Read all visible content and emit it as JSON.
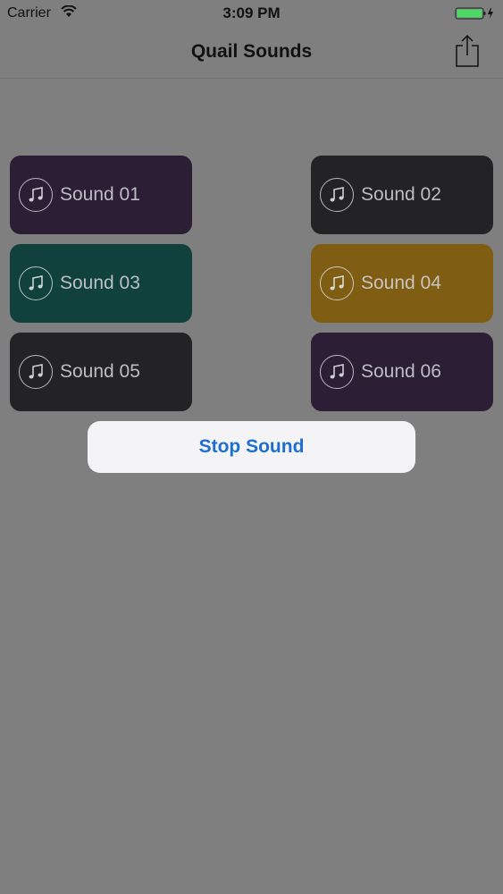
{
  "status_bar": {
    "carrier": "Carrier",
    "time": "3:09 PM"
  },
  "nav": {
    "title": "Quail Sounds"
  },
  "sounds": [
    {
      "label": "Sound 01",
      "color": "#2b1e35"
    },
    {
      "label": "Sound 02",
      "color": "#232326"
    },
    {
      "label": "Sound 03",
      "color": "#10413c"
    },
    {
      "label": "Sound 04",
      "color": "#7f5d13"
    },
    {
      "label": "Sound 05",
      "color": "#232326"
    },
    {
      "label": "Sound 06",
      "color": "#2b1e35"
    }
  ],
  "actions": {
    "stop_label": "Stop Sound",
    "stop_color": "#1e6fd0"
  },
  "colors": {
    "background": "#7f7f80",
    "battery": "#4cd964"
  }
}
